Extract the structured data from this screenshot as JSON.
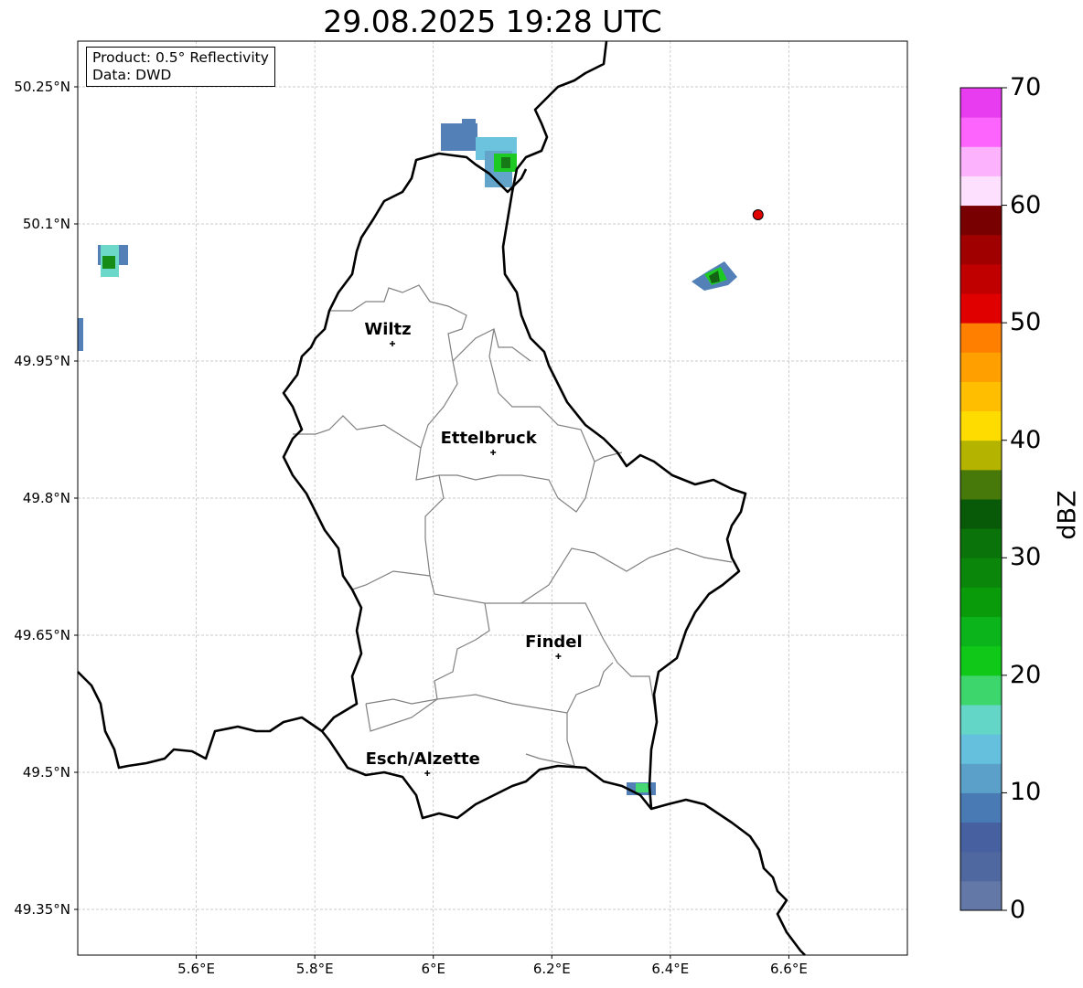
{
  "title": "29.08.2025 19:28 UTC",
  "info_box": {
    "product": "Product: 0.5° Reflectivity",
    "data": "Data: DWD"
  },
  "map": {
    "lon_range": [
      5.4,
      6.8
    ],
    "lat_range": [
      49.3,
      50.3
    ],
    "lon_ticks": [
      {
        "v": 5.6,
        "label": "5.6°E"
      },
      {
        "v": 5.8,
        "label": "5.8°E"
      },
      {
        "v": 6.0,
        "label": "6°E"
      },
      {
        "v": 6.2,
        "label": "6.2°E"
      },
      {
        "v": 6.4,
        "label": "6.4°E"
      },
      {
        "v": 6.6,
        "label": "6.6°E"
      }
    ],
    "lat_ticks": [
      {
        "v": 50.25,
        "label": "50.25°N"
      },
      {
        "v": 50.1,
        "label": "50.1°N"
      },
      {
        "v": 49.95,
        "label": "49.95°N"
      },
      {
        "v": 49.8,
        "label": "49.8°N"
      },
      {
        "v": 49.65,
        "label": "49.65°N"
      },
      {
        "v": 49.5,
        "label": "49.5°N"
      },
      {
        "v": 49.35,
        "label": "49.35°N"
      }
    ],
    "cities": [
      {
        "name": "Wiltz",
        "lon": 5.931,
        "lat": 49.969
      },
      {
        "name": "Ettelbruck",
        "lon": 6.101,
        "lat": 49.85
      },
      {
        "name": "Findel",
        "lon": 6.211,
        "lat": 49.627
      },
      {
        "name": "Esch/Alzette",
        "lon": 5.99,
        "lat": 49.499
      }
    ],
    "radar_marker": {
      "lon": 6.548,
      "lat": 50.11,
      "color": "#e00000"
    }
  },
  "colorbar": {
    "label": "dBZ",
    "min": 0,
    "max": 70,
    "step": 2.5,
    "tick_labels": [
      "0",
      "10",
      "20",
      "30",
      "40",
      "50",
      "60",
      "70"
    ],
    "colors": [
      "#6478a8",
      "#5068a0",
      "#4660a0",
      "#4a7ab4",
      "#5aa0c8",
      "#64c0dc",
      "#64d6c8",
      "#3cd66c",
      "#10c818",
      "#0cb41c",
      "#0a9b0a",
      "#0a870a",
      "#0a730a",
      "#085a08",
      "#46780a",
      "#b4b400",
      "#ffdc00",
      "#ffbf00",
      "#ff9f00",
      "#ff7f00",
      "#e00000",
      "#c00000",
      "#a00000",
      "#780000",
      "#fde0fd",
      "#fdb2fd",
      "#fd64fd",
      "#e83cf0"
    ]
  }
}
